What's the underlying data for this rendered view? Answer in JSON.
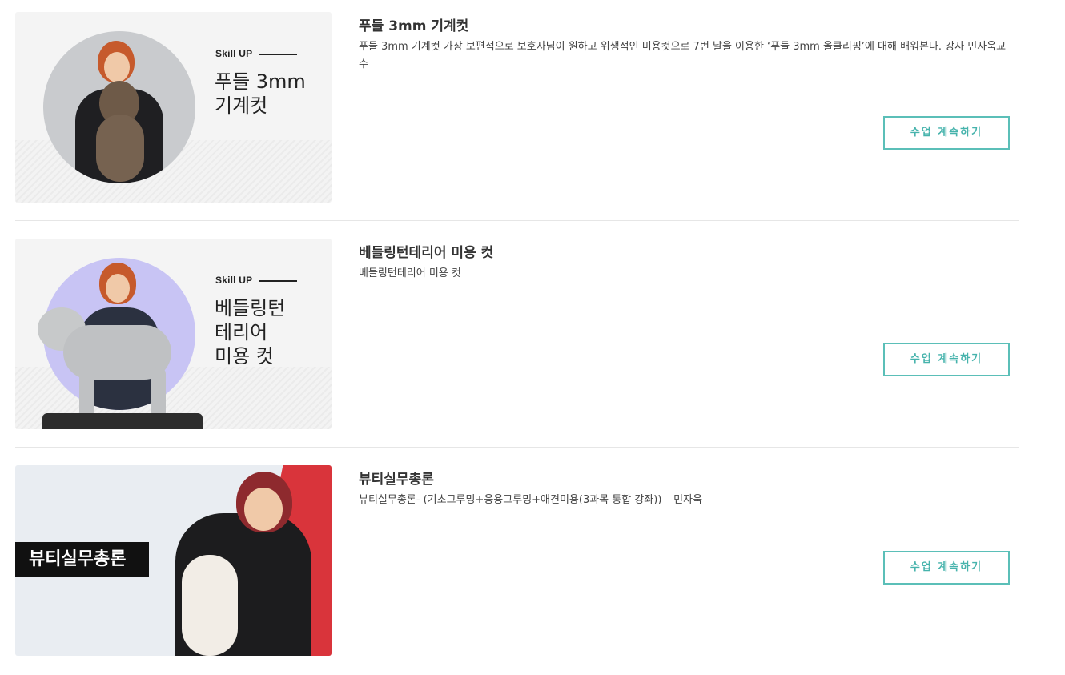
{
  "courses": [
    {
      "title": "푸들 3mm 기계컷",
      "description": "푸들 3mm 기계컷 가장 보편적으로 보호자님이 원하고 위생적인 미용컷으로 7번 날을 이용한 ‘푸들 3mm 올클리핑’에 대해 배워본다. 강사 민자욱교수",
      "thumb_tag": "Skill UP",
      "thumb_title_lines": [
        "푸들 3mm",
        "기계컷"
      ],
      "button_label": "수업 계속하기"
    },
    {
      "title": "베들링턴테리어 미용 컷",
      "description": "베들링턴테리어 미용 컷",
      "thumb_tag": "Skill UP",
      "thumb_title_lines": [
        "베들링턴",
        "테리어",
        "미용 컷"
      ],
      "button_label": "수업 계속하기"
    },
    {
      "title": "뷰티실무총론",
      "description": "뷰티실무총론- (기초그루밍+응용그루밍+애견미용(3과목 통합 강좌)) – 민자욱",
      "thumb_banner": "뷰티실무총론",
      "button_label": "수업 계속하기"
    }
  ],
  "colors": {
    "accent": "#5bbfb8",
    "circle_gray": "#c9cbce",
    "circle_lavender": "#c8c4f4",
    "red_corner": "#d9343b"
  }
}
